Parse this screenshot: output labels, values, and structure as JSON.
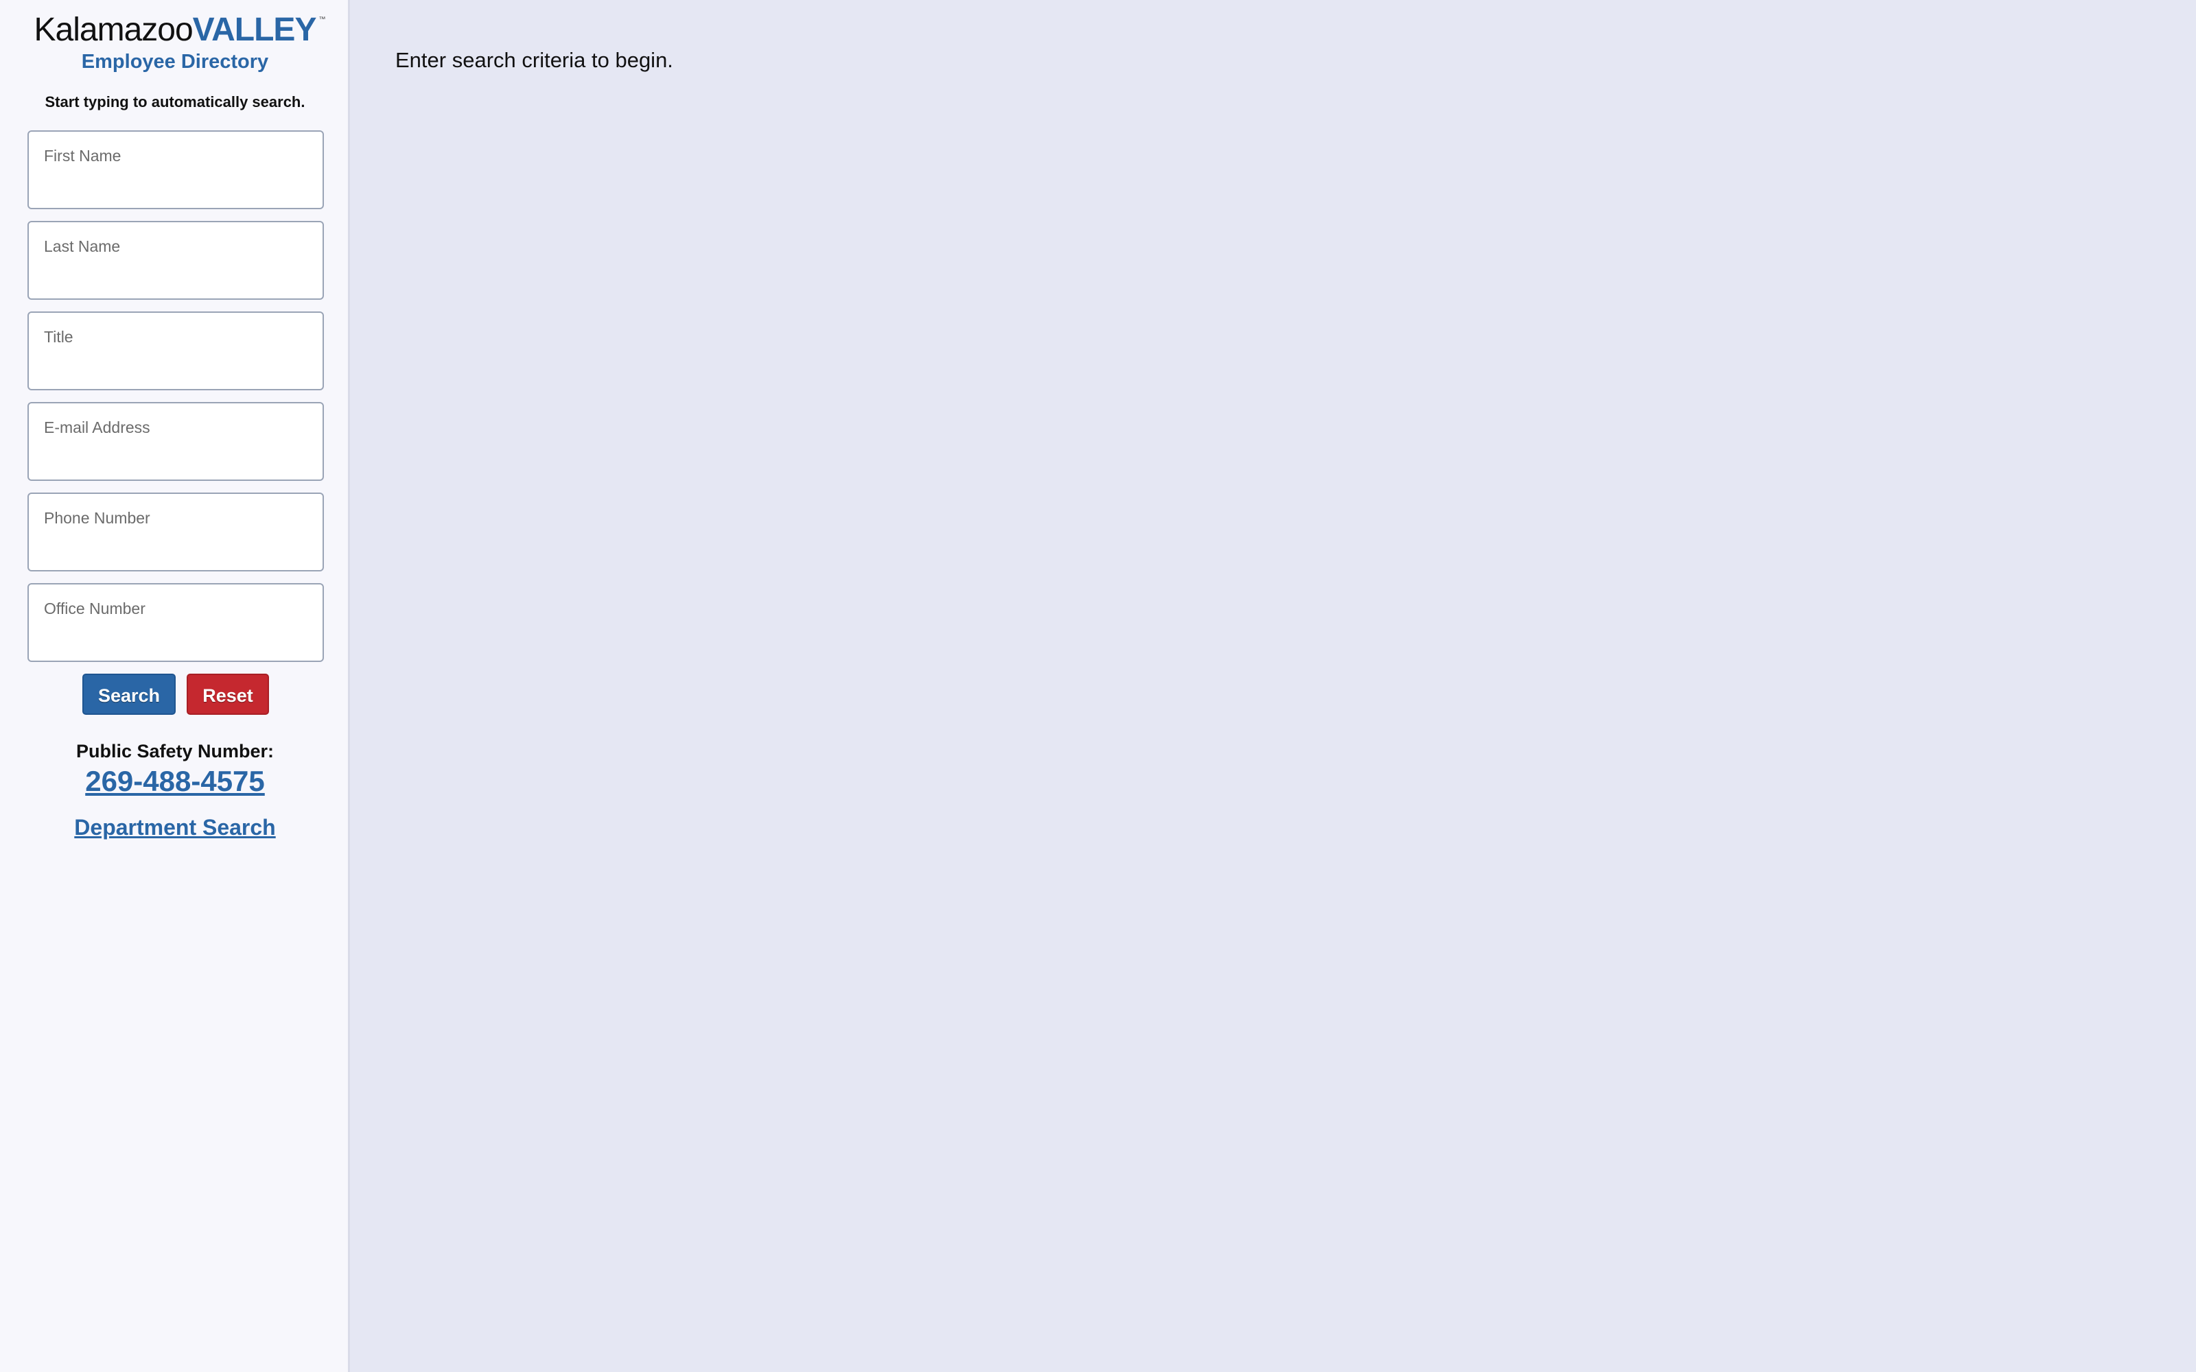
{
  "logo": {
    "part1": "Kalamazoo",
    "part2": "VALLEY",
    "tm": "™",
    "subtitle": "Employee Directory"
  },
  "sidebar": {
    "hint": "Start typing to automatically search.",
    "fields": [
      {
        "label": "First Name",
        "value": ""
      },
      {
        "label": "Last Name",
        "value": ""
      },
      {
        "label": "Title",
        "value": ""
      },
      {
        "label": "E-mail Address",
        "value": ""
      },
      {
        "label": "Phone Number",
        "value": ""
      },
      {
        "label": "Office Number",
        "value": ""
      }
    ],
    "search_button": "Search",
    "reset_button": "Reset",
    "safety_label": "Public Safety Number:",
    "safety_number": "269-488-4575",
    "department_link": "Department Search"
  },
  "main": {
    "message": "Enter search criteria to begin."
  },
  "colors": {
    "brand_blue": "#2a66a6",
    "reset_red": "#c5282f",
    "sidebar_bg": "#f7f7fc",
    "main_bg": "#e5e7f3"
  }
}
